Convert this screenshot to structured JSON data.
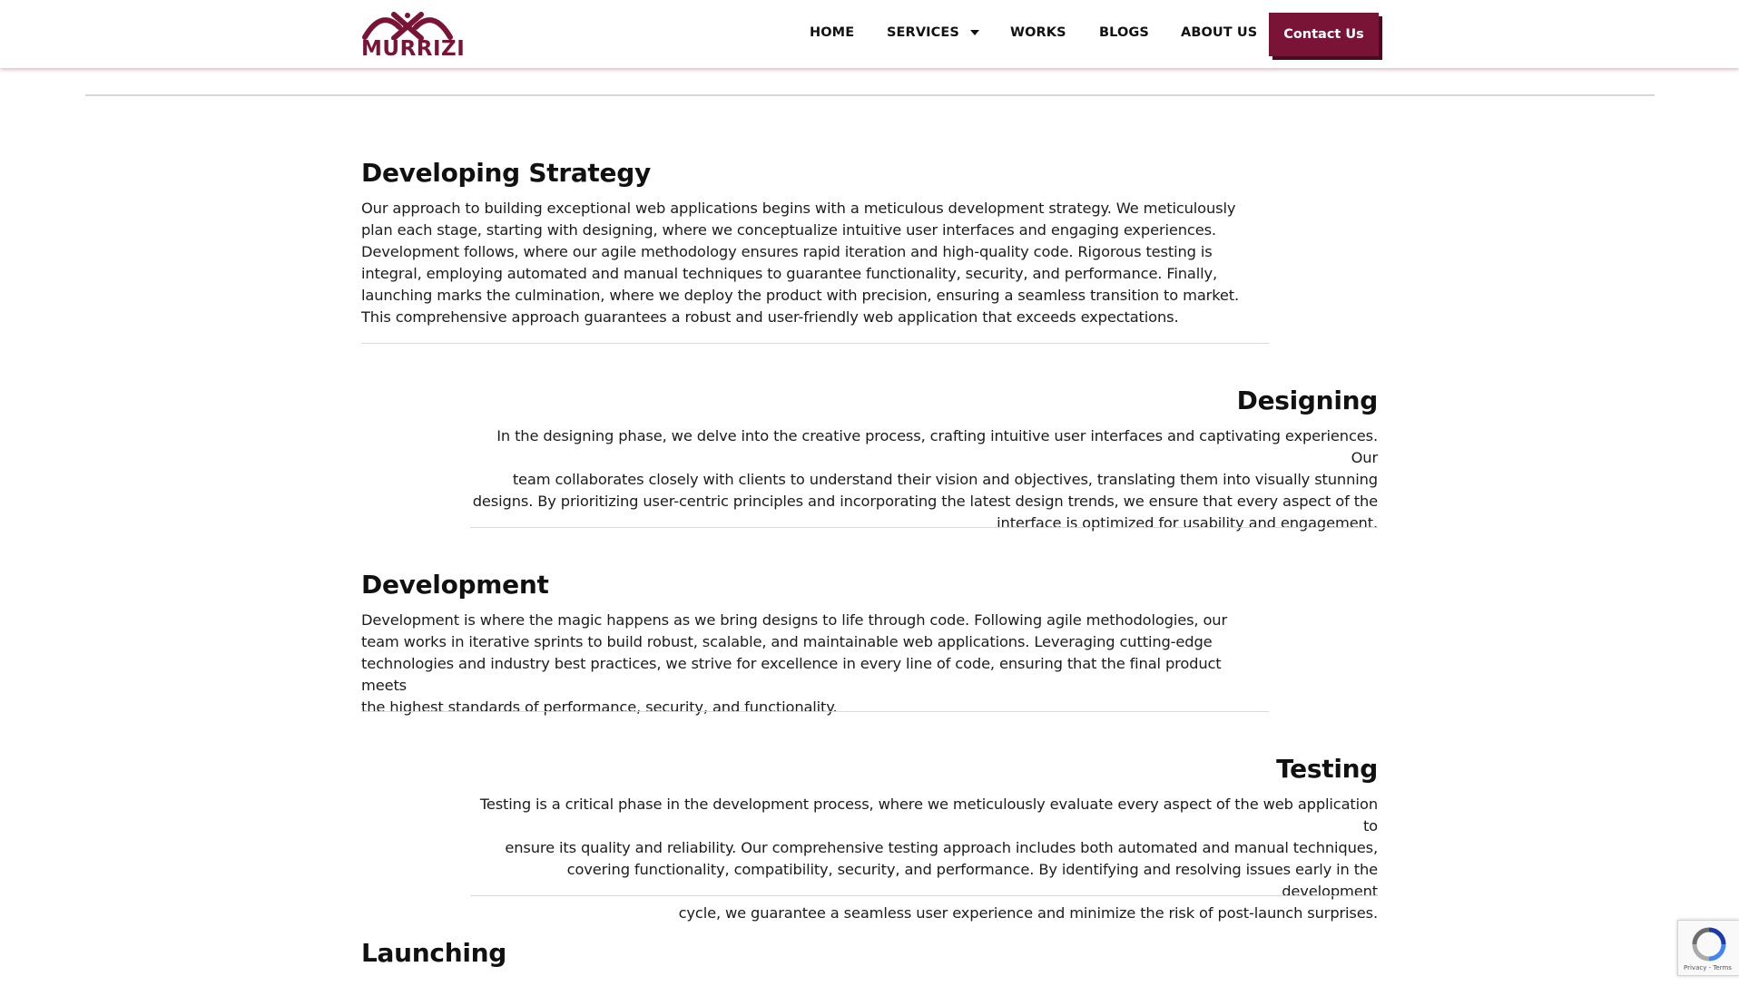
{
  "brand": {
    "name": "MURRIZI",
    "color": "#7a1436"
  },
  "nav": {
    "items": [
      {
        "label": "HOME"
      },
      {
        "label": "SERVICES"
      },
      {
        "label": "WORKS"
      },
      {
        "label": "BLOGS"
      },
      {
        "label": "ABOUT US"
      }
    ],
    "cta": "Contact Us"
  },
  "sections": [
    {
      "title": "Developing Strategy",
      "align": "left",
      "lines": [
        "Our approach to building exceptional web applications begins with a meticulous development strategy. We meticulously",
        "plan each stage, starting with designing, where we conceptualize intuitive user interfaces and engaging experiences.",
        "Development follows, where our agile methodology ensures rapid iteration and high-quality code. Rigorous testing is",
        "integral, employing automated and manual techniques to guarantee functionality, security, and performance. Finally,",
        "launching marks the culmination, where we deploy the product with precision, ensuring a seamless transition to market.",
        "This comprehensive approach guarantees a robust and user-friendly web application that exceeds expectations."
      ]
    },
    {
      "title": "Designing",
      "align": "right",
      "lines": [
        "In the designing phase, we delve into the creative process, crafting intuitive user interfaces and captivating experiences. Our",
        "team collaborates closely with clients to understand their vision and objectives, translating them into visually stunning",
        "designs. By prioritizing user-centric principles and incorporating the latest design trends, we ensure that every aspect of the",
        "interface is optimized for usability and engagement."
      ]
    },
    {
      "title": "Development",
      "align": "left",
      "lines": [
        "Development is where the magic happens as we bring designs to life through code. Following agile methodologies, our",
        "team works in iterative sprints to build robust, scalable, and maintainable web applications. Leveraging cutting-edge",
        "technologies and industry best practices, we strive for excellence in every line of code, ensuring that the final product meets",
        "the highest standards of performance, security, and functionality."
      ]
    },
    {
      "title": "Testing",
      "align": "right",
      "lines": [
        "Testing is a critical phase in the development process, where we meticulously evaluate every aspect of the web application to",
        "ensure its quality and reliability. Our comprehensive testing approach includes both automated and manual techniques,",
        "covering functionality, compatibility, security, and performance. By identifying and resolving issues early in the development",
        "cycle, we guarantee a seamless user experience and minimize the risk of post-launch surprises."
      ]
    },
    {
      "title": "Launching",
      "align": "left",
      "lines": []
    }
  ],
  "recaptcha": {
    "label": "Privacy - Terms",
    "icon": "recaptcha-icon"
  }
}
